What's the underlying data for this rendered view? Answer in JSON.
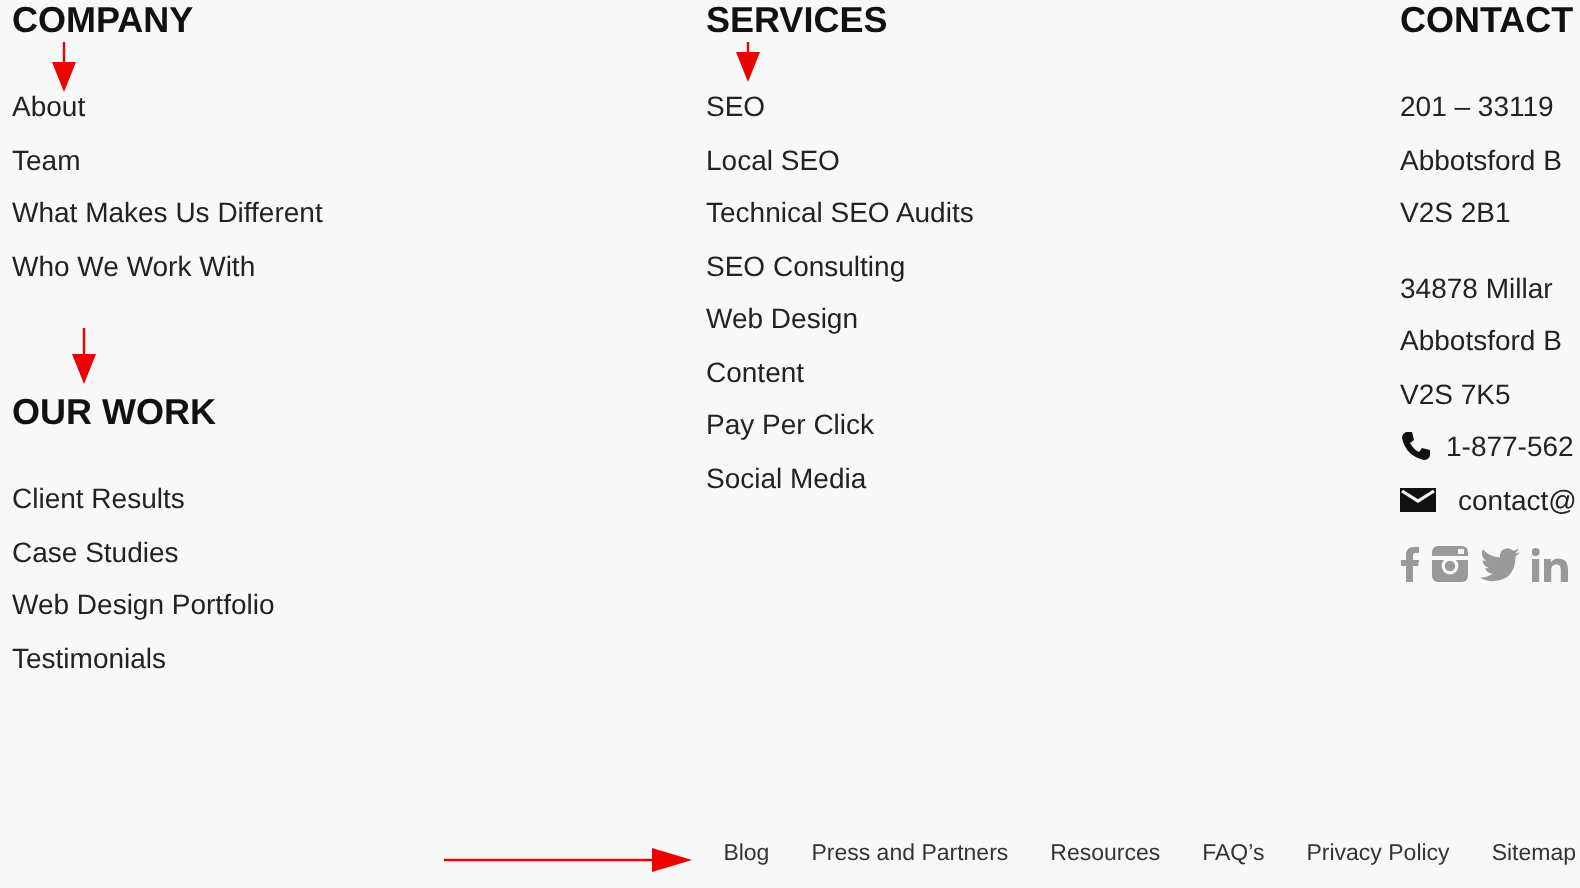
{
  "company": {
    "heading": "COMPANY",
    "links": [
      "About",
      "Team",
      "What Makes Us Different",
      "Who We Work With"
    ]
  },
  "our_work": {
    "heading": "OUR WORK",
    "links": [
      "Client Results",
      "Case Studies",
      "Web Design Portfolio",
      "Testimonials"
    ]
  },
  "services": {
    "heading": "SERVICES",
    "links": [
      "SEO",
      "Local SEO",
      "Technical SEO Audits",
      "SEO Consulting",
      "Web Design",
      "Content",
      "Pay Per Click",
      "Social Media"
    ]
  },
  "contact": {
    "heading": "CONTACT",
    "addresses": [
      [
        "201 – 33119",
        "Abbotsford B",
        "V2S 2B1"
      ],
      [
        "34878 Millar",
        "Abbotsford B",
        "V2S 7K5"
      ]
    ],
    "phone": "1-877-562",
    "email": "contact@"
  },
  "footer_links": [
    "Blog",
    "Press and Partners",
    "Resources",
    "FAQ’s",
    "Privacy Policy",
    "Sitemap"
  ]
}
